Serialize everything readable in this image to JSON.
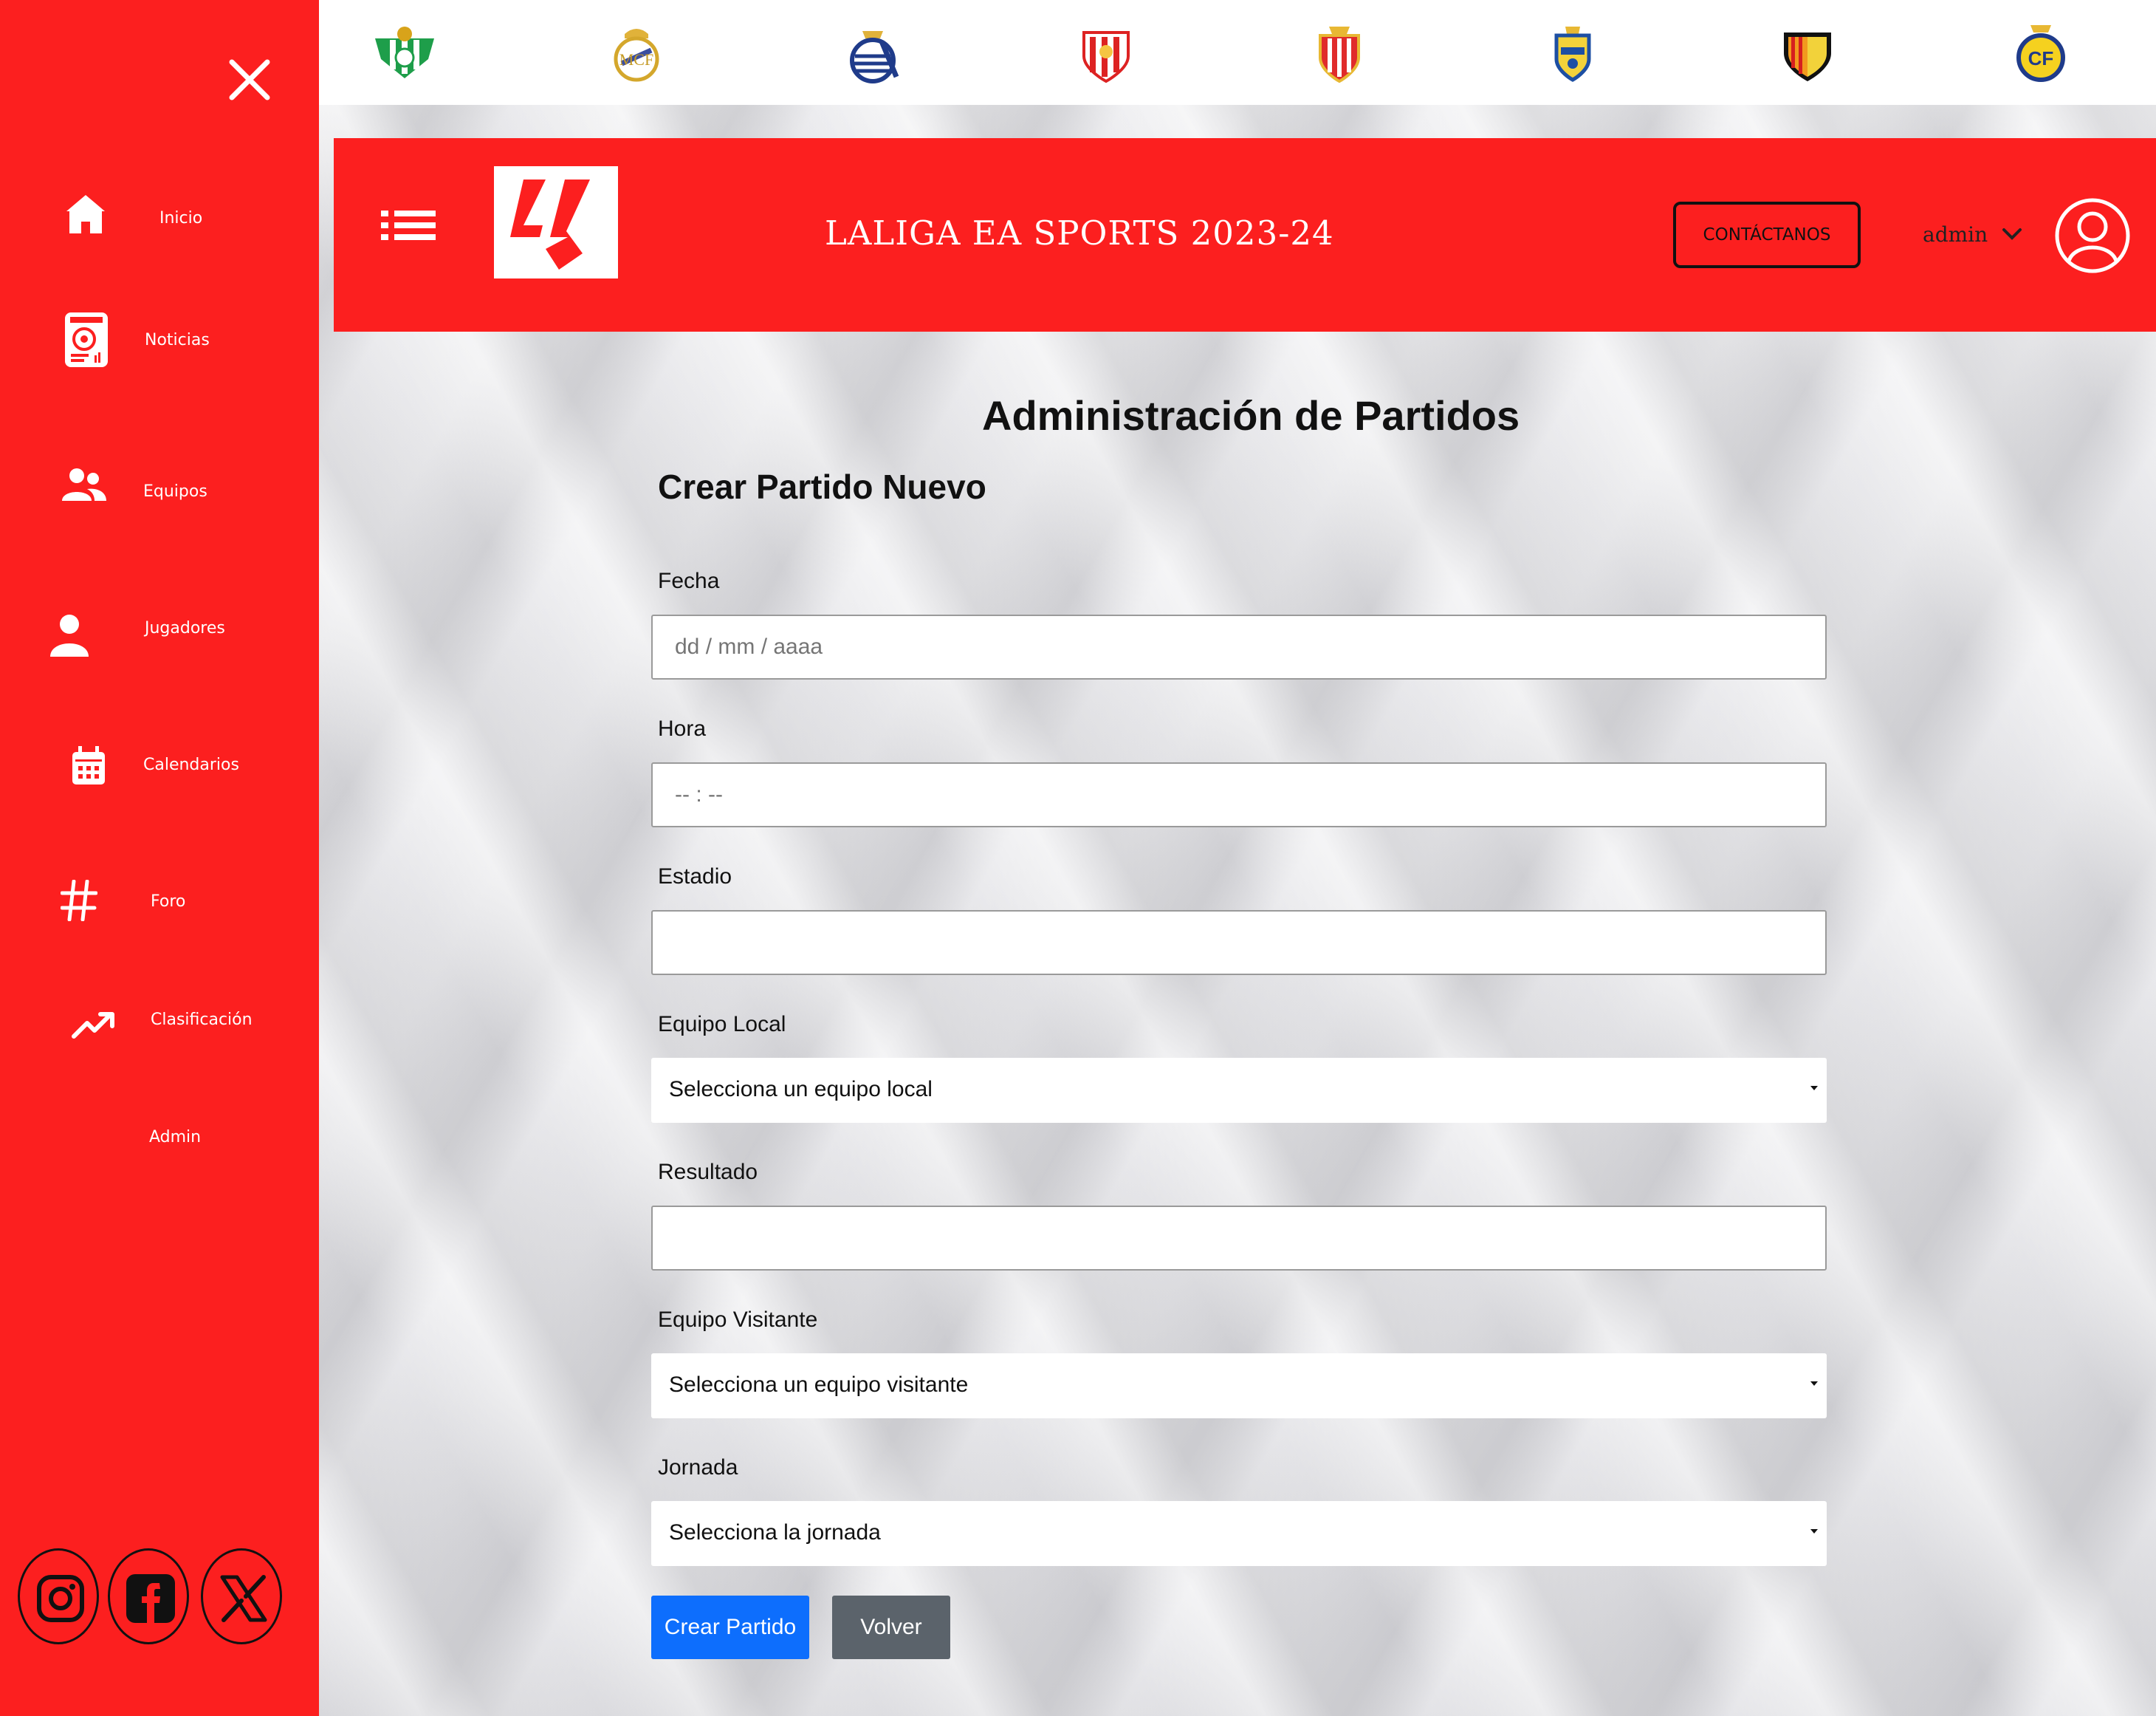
{
  "colors": {
    "brand_red": "#fc1f1f",
    "primary": "#0d6efd",
    "secondary": "#5b636b"
  },
  "sidebar": {
    "close_icon": "close-icon",
    "items": [
      {
        "label": "Inicio",
        "icon": "home-icon"
      },
      {
        "label": "Noticias",
        "icon": "news-icon"
      },
      {
        "label": "Equipos",
        "icon": "team-icon"
      },
      {
        "label": "Jugadores",
        "icon": "person-icon"
      },
      {
        "label": "Calendarios",
        "icon": "calendar-icon"
      },
      {
        "label": "Foro",
        "icon": "hashtag-icon"
      },
      {
        "label": "Clasificación",
        "icon": "trending-up-icon"
      },
      {
        "label": "Admin",
        "icon": ""
      }
    ],
    "socials": [
      "instagram-icon",
      "facebook-icon",
      "x-icon"
    ]
  },
  "clubs": [
    "Real Betis",
    "Real Madrid",
    "Real Sociedad",
    "Sevilla",
    "Almería",
    "Las Palmas",
    "Valencia",
    "Villarreal"
  ],
  "header": {
    "title": "LALIGA EA SPORTS 2023-24",
    "contact_label": "CONTÁCTANOS",
    "username": "admin"
  },
  "form": {
    "page_title": "Administración de Partidos",
    "section_title": "Crear Partido Nuevo",
    "fields": {
      "fecha": {
        "label": "Fecha",
        "placeholder": "dd / mm / aaaa"
      },
      "hora": {
        "label": "Hora",
        "placeholder": "-- : --"
      },
      "estadio": {
        "label": "Estadio",
        "value": ""
      },
      "equipo_local": {
        "label": "Equipo Local",
        "selected": "Selecciona un equipo local"
      },
      "resultado": {
        "label": "Resultado",
        "value": ""
      },
      "equipo_visitante": {
        "label": "Equipo Visitante",
        "selected": "Selecciona un equipo visitante"
      },
      "jornada": {
        "label": "Jornada",
        "selected": "Selecciona la jornada"
      }
    },
    "submit_label": "Crear Partido",
    "back_label": "Volver"
  }
}
